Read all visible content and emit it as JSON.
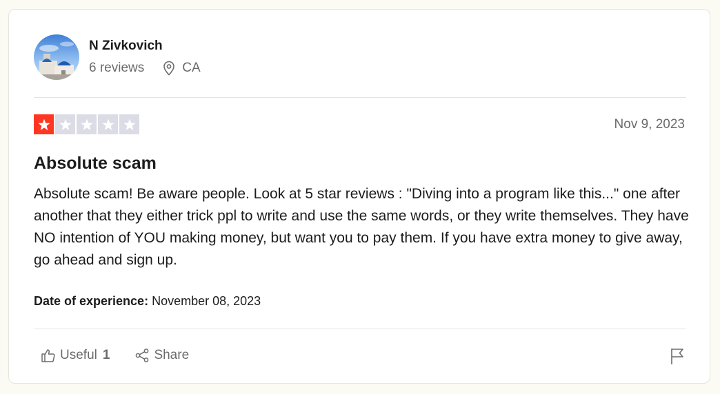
{
  "consumer": {
    "name": "N Zivkovich",
    "reviews_count": "6 reviews",
    "country": "CA",
    "avatar_icon": "avatar-photo"
  },
  "review": {
    "rating": 1,
    "rating_max": 5,
    "star_color": "#ff3722",
    "empty_star_color": "#dcdce6",
    "date": "Nov 9, 2023",
    "title": "Absolute scam",
    "body": "Absolute scam! Be aware people. Look at 5 star reviews : \"Diving into a program like this...\" one after another that they either trick ppl to write and use the same words, or they write themselves. They have NO intention of YOU making money, but want you to pay them. If you have extra money to give away, go ahead and sign up.",
    "experience_label": "Date of experience:",
    "experience_date": "November 08, 2023"
  },
  "actions": {
    "useful_label": "Useful",
    "useful_count": "1",
    "useful_icon": "thumbs-up-icon",
    "share_label": "Share",
    "share_icon": "share-icon",
    "flag_icon": "flag-icon"
  }
}
